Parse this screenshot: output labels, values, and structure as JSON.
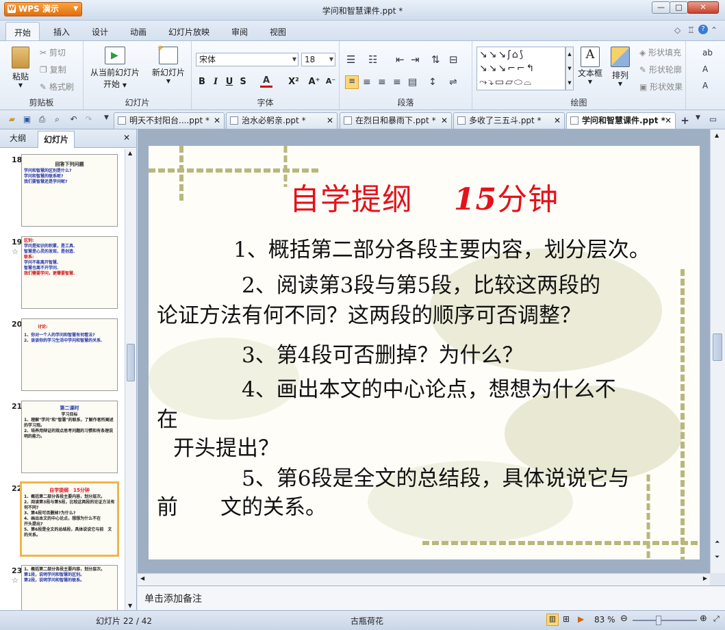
{
  "app": {
    "menu_button": "WPS 演示",
    "title": "学问和智慧课件.ppt *"
  },
  "window_buttons": {
    "minimize": "—",
    "maximize": "□",
    "close": "✕"
  },
  "menu_tabs": [
    "开始",
    "插入",
    "设计",
    "动画",
    "幻灯片放映",
    "审阅",
    "视图"
  ],
  "ribbon": {
    "paste": "粘贴",
    "cut": "剪切",
    "copy": "复制",
    "format_painter": "格式刷",
    "clipboard_group": "剪贴板",
    "from_current_l1": "从当前幻灯片",
    "from_current_l2": "开始",
    "new_slide": "新幻灯片",
    "slides_group": "幻灯片",
    "font_name": "宋体",
    "font_size": "18",
    "font_group": "字体",
    "paragraph_group": "段落",
    "textbox": "文本框",
    "arrange": "排列",
    "shape_fill": "形状填充",
    "shape_outline": "形状轮廓",
    "shape_effect": "形状效果",
    "drawing_group": "绘图"
  },
  "doc_tabs": [
    {
      "label": "明天不封阳台....ppt *"
    },
    {
      "label": "治水必躬亲.ppt *"
    },
    {
      "label": "在烈日和暴雨下.ppt *"
    },
    {
      "label": "多收了三五斗.ppt *"
    },
    {
      "label": "学问和智慧课件.ppt *"
    }
  ],
  "panel": {
    "tab_outline": "大纲",
    "tab_slides": "幻灯片"
  },
  "thumbs": {
    "t18": {
      "num": "18",
      "title": "回答下列问题",
      "l1": "学问和智慧的区别是什么?",
      "l2": "学问和智慧的联系呢?",
      "l3": "我们要智慧还是学问呢?"
    },
    "t19": {
      "num": "19",
      "star": "☆",
      "l1": "区别:",
      "l2": "学问是知识的积累，是工具.",
      "l3": "智慧是心灵的发现，是创造.",
      "l4": "联系:",
      "l5": "学问不能离开智慧.",
      "l6": "智慧也离不开学问.",
      "l7": "我们需要学问，更需要智慧."
    },
    "t20": {
      "num": "20",
      "l1": "讨论:",
      "l2": "1、你对一个人的学问和智慧有何看法?",
      "l3": "2、谈谈你的学习生活中学问和智慧的关系."
    },
    "t21": {
      "num": "21",
      "title": "第二课时",
      "l1": "学习目标",
      "l2": "1、理解\"学问\"和\"智慧\"的联系，了解作者所阐述的学习观。",
      "l3": "2、培养用辩证的观点思考问题的习惯和有条理说明的能力。"
    },
    "t22": {
      "num": "22",
      "title": "自学提纲　15分钟",
      "l1": "1、概括第二部分各段主要内容，划分层次。",
      "l2": "2、阅读第3段与第5段，比较这两段的论证方法有何不同?",
      "l3": "3、第4段可否删掉?为什么?",
      "l4": "4、画出本文的中心论点，想想为什么不在",
      "l5": "开头提出?",
      "l6": "5、第6段是全文的总结段，具体说说它与前　文的关系。"
    },
    "t23": {
      "num": "23",
      "star": "☆",
      "l1": "1、概括第二部分各段主要内容，划分层次。",
      "l2": "第1段，说明学问和智慧的区别。",
      "l3": "第2段，说明学问和智慧的联系。"
    }
  },
  "slide": {
    "title_part1": "自学提纲",
    "title_part2": "15",
    "title_part3": "分钟",
    "line1": "1、概括第二部分各段主要内容，划分层次。",
    "line2a": "2、阅读第3段与第5段，比较这两段的",
    "line2b": "论证方法有何不同？这两段的顺序可否调整？",
    "line3": "3、第4段可否删掉？为什么？",
    "line4a": "4、画出本文的中心论点，想想为什么不",
    "line4b": "在",
    "line4c": "开头提出？",
    "line5a": "5、第6段是全文的总结段，具体说说它与",
    "line5b": "前　　文的关系。"
  },
  "notes_placeholder": "单击添加备注",
  "status": {
    "slide_count": "幻灯片 22 / 42",
    "theme": "古瓶荷花",
    "zoom": "83 %"
  },
  "colors": {
    "title_red": "#e4121a",
    "wps_orange": "#e36f0c",
    "selection": "#f0b548"
  }
}
